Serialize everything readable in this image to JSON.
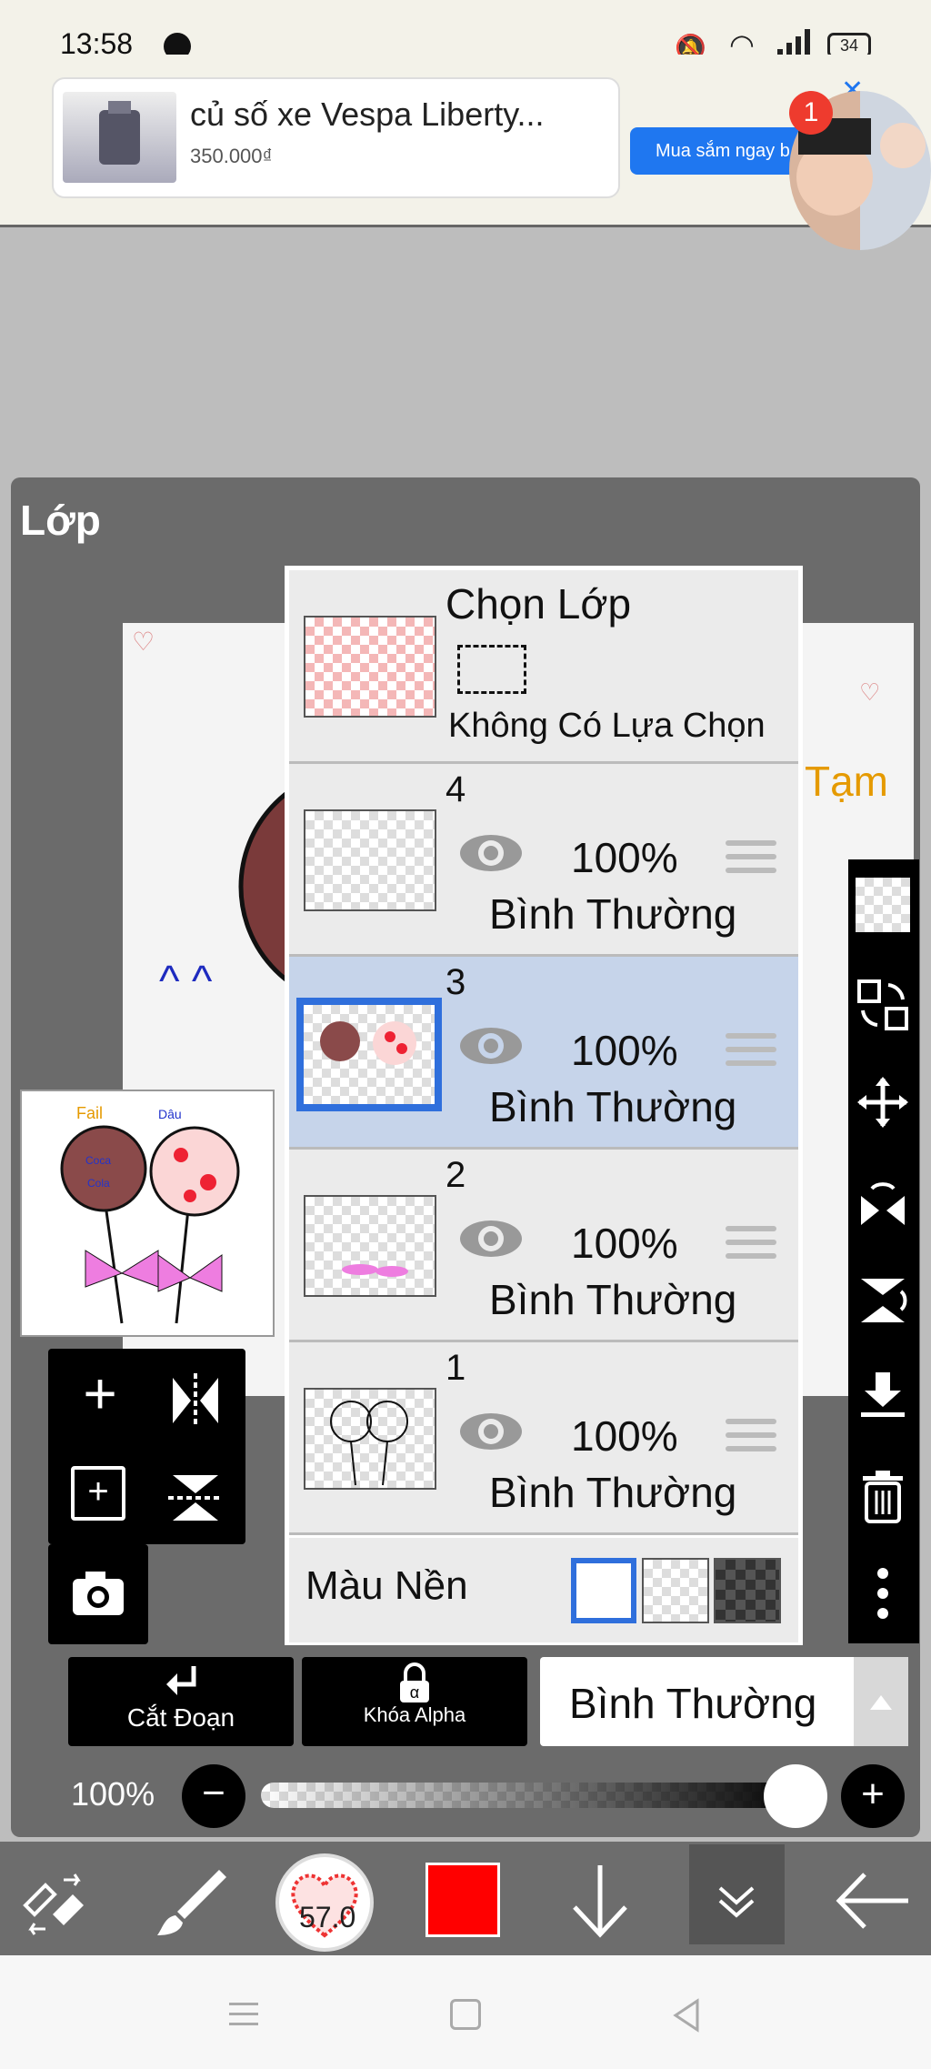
{
  "status": {
    "time": "13:58",
    "battery": "34"
  },
  "ad": {
    "title": "củ số xe Vespa Liberty...",
    "price": "350.000₫",
    "cta": "Mua sắm ngay b",
    "badge": "1"
  },
  "panel": {
    "title": "Lớp"
  },
  "selection": {
    "title": "Chọn Lớp",
    "subtitle": "Không Có Lựa Chọn"
  },
  "layers": [
    {
      "num": "4",
      "opacity": "100%",
      "mode": "Bình Thường"
    },
    {
      "num": "3",
      "opacity": "100%",
      "mode": "Bình Thường"
    },
    {
      "num": "2",
      "opacity": "100%",
      "mode": "Bình Thường"
    },
    {
      "num": "1",
      "opacity": "100%",
      "mode": "Bình Thường"
    }
  ],
  "background": {
    "label": "Màu Nền"
  },
  "controls": {
    "clip_label": "Cắt Đoạn",
    "alpha_lock_label": "Khóa Alpha",
    "blend_mode": "Bình Thường",
    "opacity_value": "100%",
    "opacity_fraction": 1.0
  },
  "toolbar": {
    "brush_size": "57.0",
    "color": "#ff0000"
  },
  "canvas": {
    "thumb_text_1": "Coca",
    "thumb_text_2": "Cola",
    "thumb_text_3": "Fail",
    "thumb_text_4": "Dâu"
  }
}
